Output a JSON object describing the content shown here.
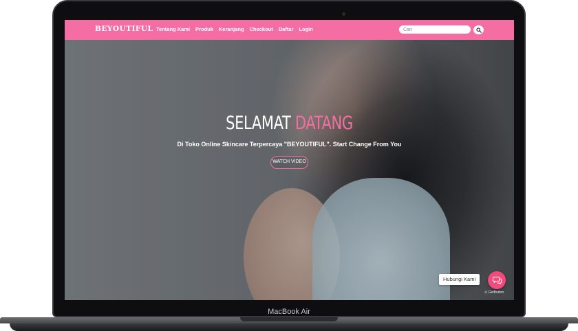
{
  "device": {
    "model_label": "MacBook Air"
  },
  "navbar": {
    "brand": "BEYOUTIFUL",
    "links": [
      "Tentang Kami",
      "Produk",
      "Keranjang",
      "Checkout",
      "Daftar",
      "Login"
    ],
    "search": {
      "placeholder": "Cari"
    },
    "search_icon": "search-icon"
  },
  "hero": {
    "title_main": "SELAMAT",
    "title_accent": "DATANG",
    "subtitle": "Di Toko Online Skincare Terpercaya \"BEYOUTIFUL\". Start Change From You",
    "watch_button": "WATCH VIDEO"
  },
  "chat_widget": {
    "label": "Hubungi Kami",
    "icon": "chat-icon",
    "powered_by": "GetButton"
  },
  "colors": {
    "brand_pink": "#f46ea3",
    "chat_pink": "#f4497d",
    "text_white": "#ffffff"
  }
}
